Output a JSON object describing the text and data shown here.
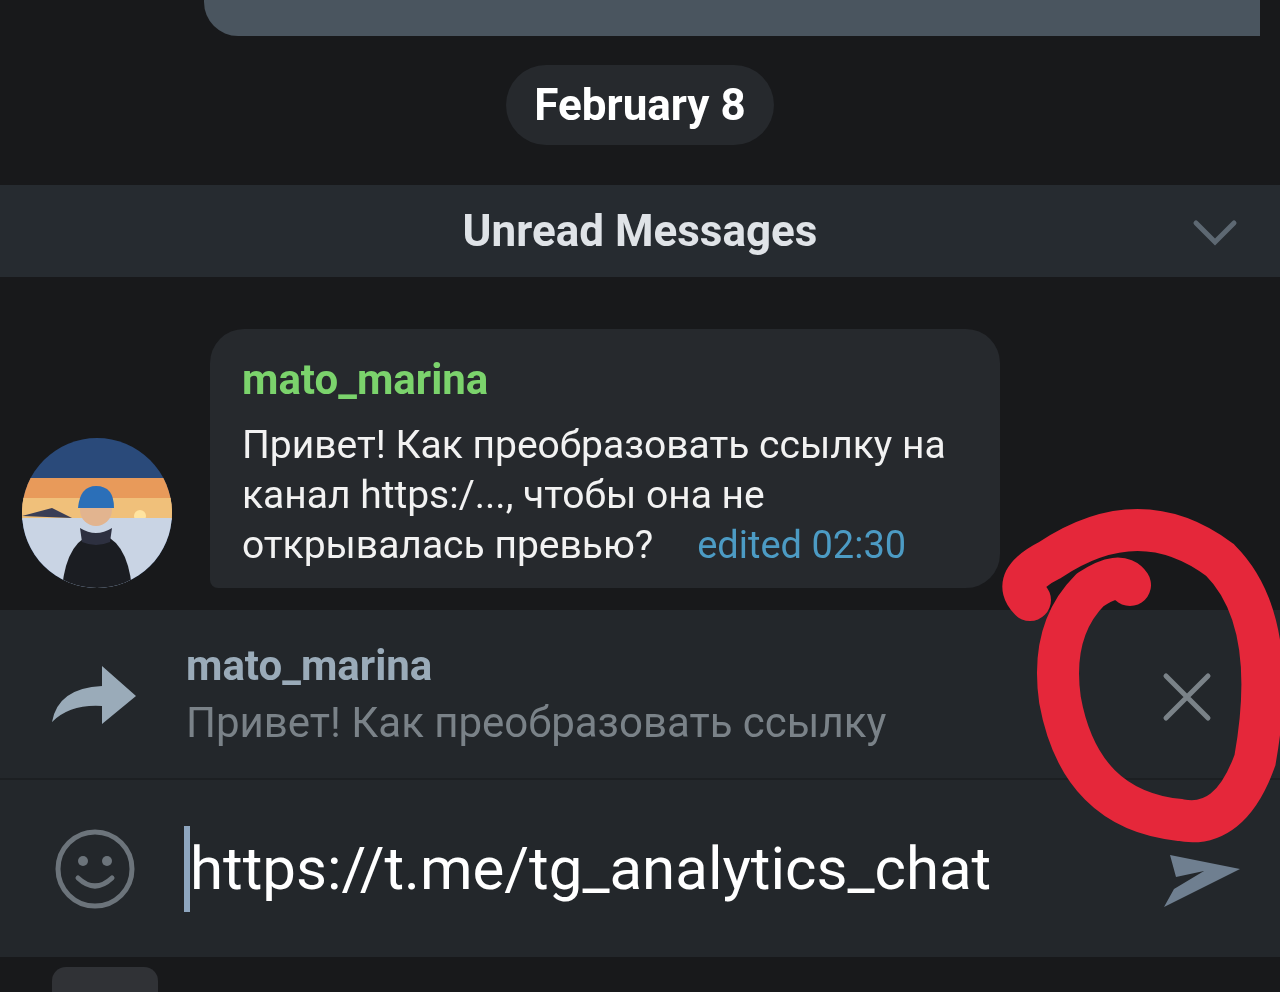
{
  "date_chip": "February 8",
  "unread_bar": {
    "label": "Unread Messages"
  },
  "message": {
    "sender": "mato_marina",
    "text": "Привет! Как преобразовать ссылку на канал https:/..., чтобы она не открывалась превью?",
    "meta": "edited 02:30"
  },
  "reply_preview": {
    "sender": "mato_marina",
    "text": "Привет! Как преобразовать ссылку"
  },
  "composer": {
    "value": "https://t.me/tg_analytics_chat"
  }
}
